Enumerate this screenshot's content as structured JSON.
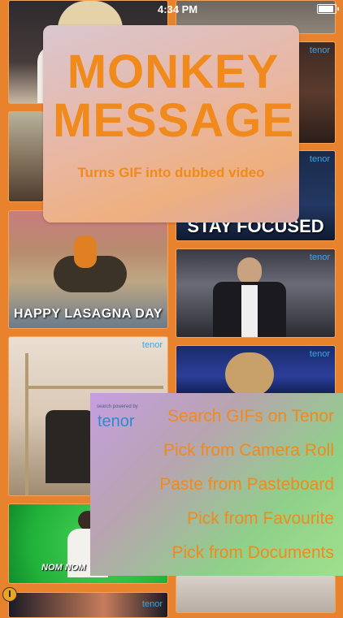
{
  "status_bar": {
    "time": "4:34 PM"
  },
  "title_card": {
    "title_line1": "MONKEY",
    "title_line2": "MESSAGE",
    "subtitle": "Turns GIF into dubbed video"
  },
  "gif_tiles": [
    {
      "caption": "",
      "badge": ""
    },
    {
      "caption": "",
      "badge": "tenor"
    },
    {
      "caption": "",
      "badge": ""
    },
    {
      "caption": "",
      "badge": "tenor"
    },
    {
      "caption": "STAY FOCUSED",
      "badge": "tenor"
    },
    {
      "caption": "HAPPY LASAGNA DAY",
      "badge": ""
    },
    {
      "caption": "",
      "badge": "tenor"
    },
    {
      "caption": "",
      "badge": "tenor"
    },
    {
      "caption": "",
      "badge": "tenor"
    },
    {
      "caption": "NOM NOM",
      "badge": ""
    },
    {
      "caption": "",
      "badge": ""
    },
    {
      "caption": "",
      "badge": "tenor"
    },
    {
      "caption": "",
      "badge": ""
    }
  ],
  "menu": {
    "powered_by": "search powered by",
    "powered_logo": "tenor",
    "items": [
      "Search GIFs on Tenor",
      "Pick from Camera Roll",
      "Paste from Pasteboard",
      "Pick from Favourite",
      "Pick from Documents"
    ]
  },
  "colors": {
    "background": "#e9822c",
    "accent": "#f08a1c",
    "tenor_blue": "#3aa7e6"
  },
  "icons": [
    "battery-icon",
    "info-icon"
  ]
}
